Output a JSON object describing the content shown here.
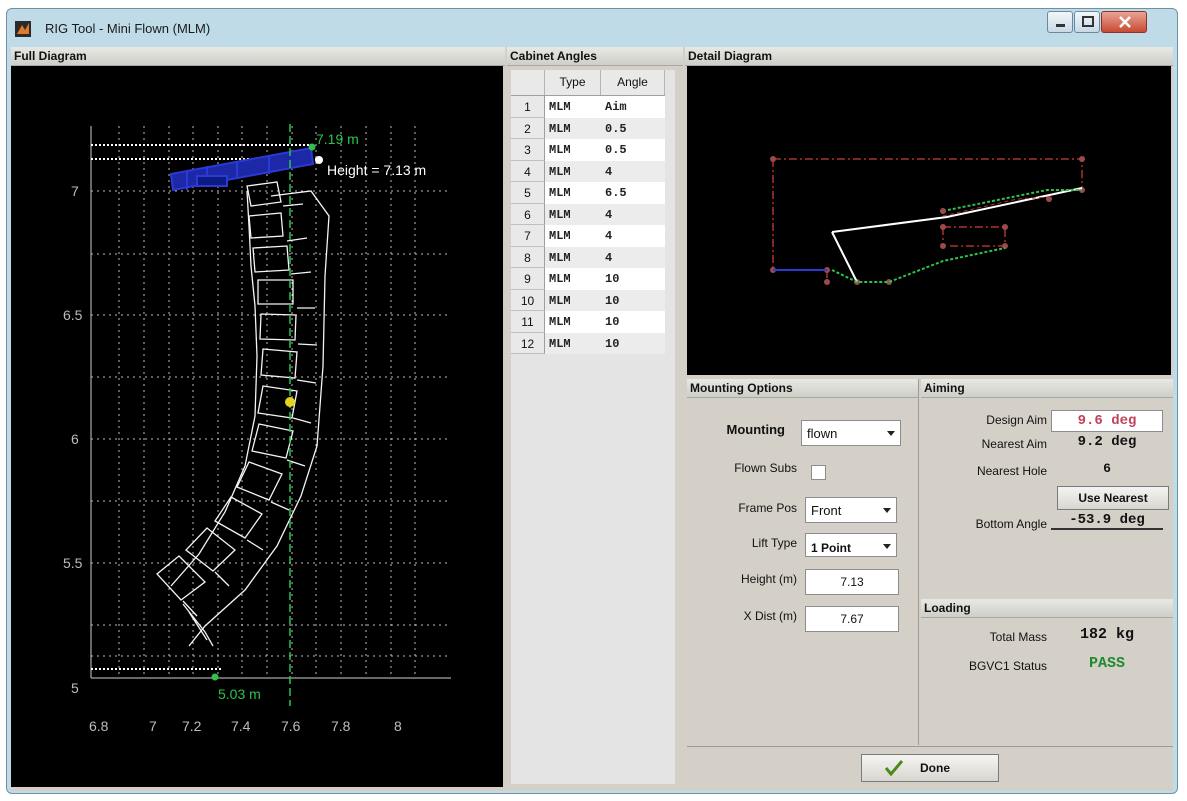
{
  "window": {
    "title": "RIG Tool - Mini Flown (MLM)"
  },
  "full_diagram": {
    "header": "Full Diagram",
    "y_ticks": [
      "7",
      "6.5",
      "6",
      "5.5",
      "5"
    ],
    "x_ticks": [
      "6.8",
      "7",
      "7.2",
      "7.4",
      "7.6",
      "7.8",
      "8"
    ],
    "top_marker_label": "7.19 m",
    "height_label": "Height = 7.13 m",
    "bottom_marker_label": "5.03 m"
  },
  "cabinet_angles": {
    "header": "Cabinet Angles",
    "columns": [
      "Type",
      "Angle"
    ],
    "rows": [
      {
        "index": "1",
        "type": "MLM",
        "angle": "Aim"
      },
      {
        "index": "2",
        "type": "MLM",
        "angle": "0.5"
      },
      {
        "index": "3",
        "type": "MLM",
        "angle": "0.5"
      },
      {
        "index": "4",
        "type": "MLM",
        "angle": "4"
      },
      {
        "index": "5",
        "type": "MLM",
        "angle": "6.5"
      },
      {
        "index": "6",
        "type": "MLM",
        "angle": "4"
      },
      {
        "index": "7",
        "type": "MLM",
        "angle": "4"
      },
      {
        "index": "8",
        "type": "MLM",
        "angle": "4"
      },
      {
        "index": "9",
        "type": "MLM",
        "angle": "10"
      },
      {
        "index": "10",
        "type": "MLM",
        "angle": "10"
      },
      {
        "index": "11",
        "type": "MLM",
        "angle": "10"
      },
      {
        "index": "12",
        "type": "MLM",
        "angle": "10"
      }
    ]
  },
  "detail_diagram": {
    "header": "Detail Diagram"
  },
  "mounting": {
    "header": "Mounting Options",
    "mounting_label": "Mounting",
    "mounting_value": "flown",
    "flown_subs_label": "Flown Subs",
    "frame_pos_label": "Frame Pos",
    "frame_pos_value": "Front",
    "lift_type_label": "Lift Type",
    "lift_type_value": "1 Point",
    "height_label": "Height (m)",
    "height_value": "7.13",
    "xdist_label": "X Dist (m)",
    "xdist_value": "7.67"
  },
  "aiming": {
    "header": "Aiming",
    "design_aim_label": "Design Aim",
    "design_aim_value": "9.6 deg",
    "nearest_aim_label": "Nearest Aim",
    "nearest_aim_value": "9.2 deg",
    "nearest_hole_label": "Nearest Hole",
    "nearest_hole_value": "6",
    "use_nearest_label": "Use Nearest",
    "bottom_angle_label": "Bottom Angle",
    "bottom_angle_value": "-53.9 deg"
  },
  "loading": {
    "header": "Loading",
    "total_mass_label": "Total Mass",
    "total_mass_value": "182 kg",
    "status_label": "BGVC1 Status",
    "status_value": "PASS"
  },
  "done_label": "Done",
  "colors": {
    "accent_red": "#b0302a",
    "pass_green": "#1f8a2e",
    "grid_white": "#dddddd",
    "marker_green": "#2ec24a",
    "bumper_blue": "#2b39d6"
  }
}
